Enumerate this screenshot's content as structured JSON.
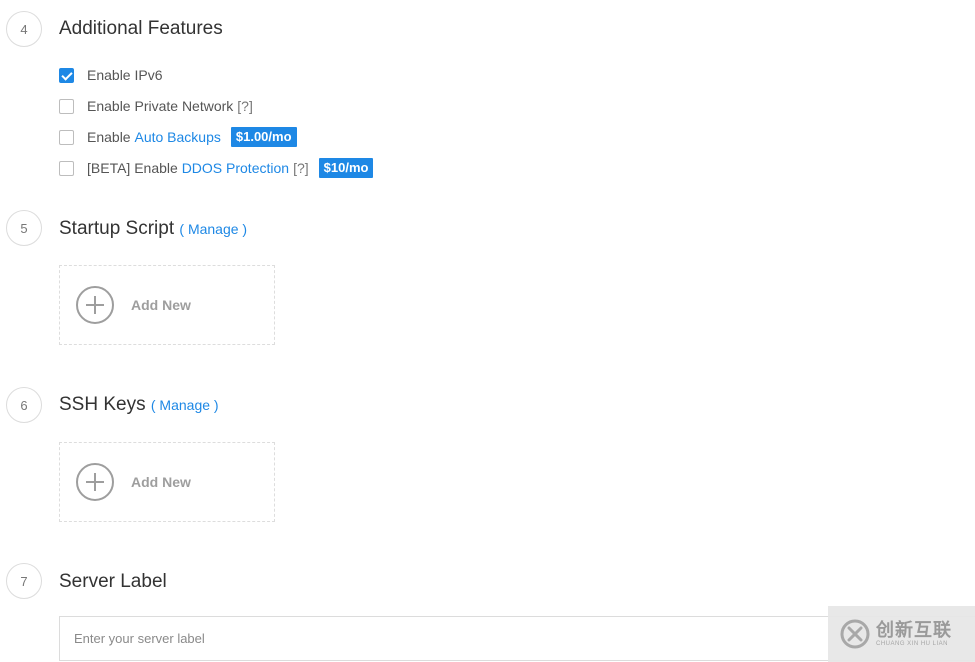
{
  "sections": {
    "additional": {
      "number": "4",
      "title": "Additional Features"
    },
    "startup": {
      "number": "5",
      "title": "Startup Script",
      "manage": "( Manage )",
      "add_label": "Add New"
    },
    "ssh": {
      "number": "6",
      "title": "SSH Keys",
      "manage": "( Manage )",
      "add_label": "Add New"
    },
    "label": {
      "number": "7",
      "title": "Server Label",
      "placeholder": "Enter your server label",
      "value": ""
    }
  },
  "features": {
    "ipv6": {
      "label": "Enable IPv6",
      "checked": true
    },
    "private_network": {
      "label": "Enable Private Network",
      "help": "[?]",
      "checked": false
    },
    "auto_backups": {
      "prefix": "Enable ",
      "link": "Auto Backups",
      "price": "$1.00/mo",
      "checked": false
    },
    "ddos": {
      "prefix": "[BETA] Enable ",
      "link": "DDOS Protection",
      "help": "[?]",
      "price": "$10/mo",
      "checked": false
    }
  },
  "colors": {
    "accent": "#1e88e5",
    "muted": "#9e9e9e",
    "border": "#dcdcdc"
  },
  "icons": {
    "checkbox_checked": "check-icon",
    "add": "plus-circle-icon",
    "watermark": "brand-logo-icon"
  },
  "watermark": {
    "brand_cn": "创新互联",
    "brand_en": "CHUANG XIN HU LIAN"
  }
}
